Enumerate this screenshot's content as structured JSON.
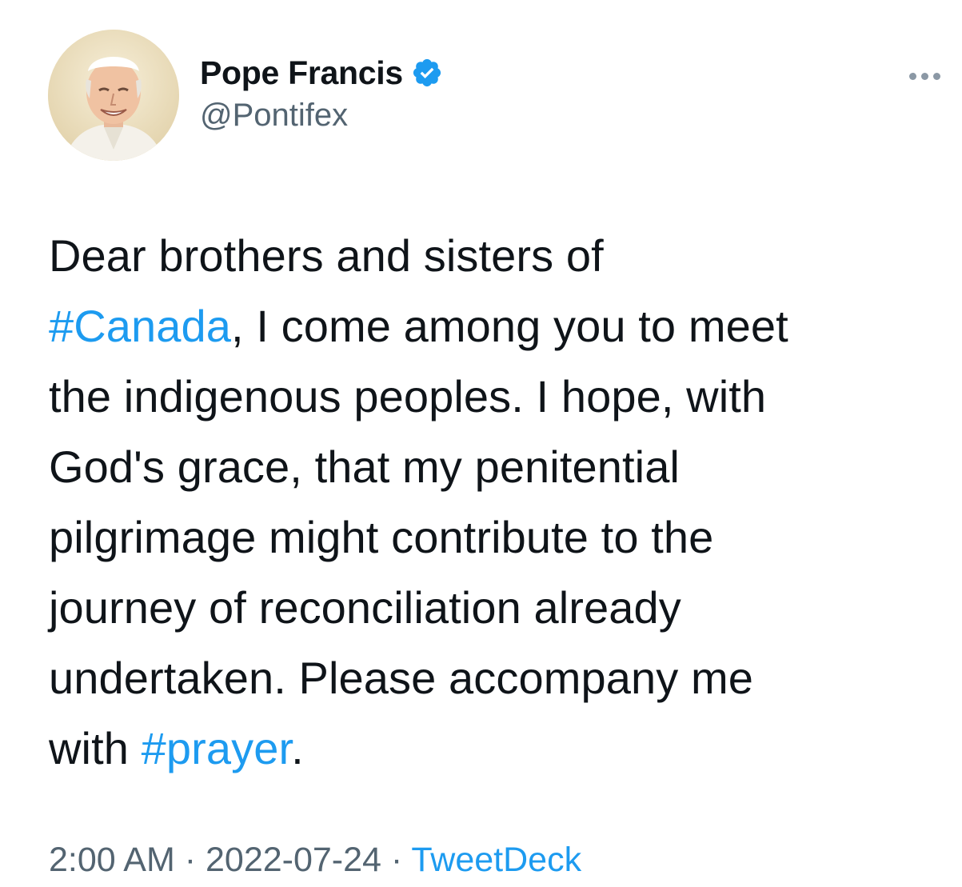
{
  "author": {
    "display_name": "Pope Francis",
    "handle": "@Pontifex",
    "verified_icon": "verified-badge-icon",
    "avatar_icon": "profile-photo"
  },
  "menu": {
    "more_icon": "more-horizontal-icon"
  },
  "tweet": {
    "lines": [
      {
        "pre": "Dear brothers and sisters of",
        "tag": "",
        "post": ""
      },
      {
        "pre": "",
        "tag": "#Canada",
        "post": ", I come among you to meet"
      },
      {
        "pre": "the indigenous peoples. I hope, with",
        "tag": "",
        "post": ""
      },
      {
        "pre": "God's grace, that my penitential",
        "tag": "",
        "post": ""
      },
      {
        "pre": "pilgrimage might contribute to the",
        "tag": "",
        "post": ""
      },
      {
        "pre": "journey of reconciliation already",
        "tag": "",
        "post": ""
      },
      {
        "pre": "undertaken. Please accompany me",
        "tag": "",
        "post": ""
      },
      {
        "pre": "with ",
        "tag": "#prayer",
        "post": "."
      }
    ]
  },
  "meta": {
    "time": "2:00 AM",
    "separator": " · ",
    "date": "2022-07-24",
    "source": "TweetDeck"
  },
  "colors": {
    "link": "#1d9bf0",
    "secondary_text": "#536471",
    "primary_text": "#0f1419",
    "verified": "#1d9bf0"
  }
}
